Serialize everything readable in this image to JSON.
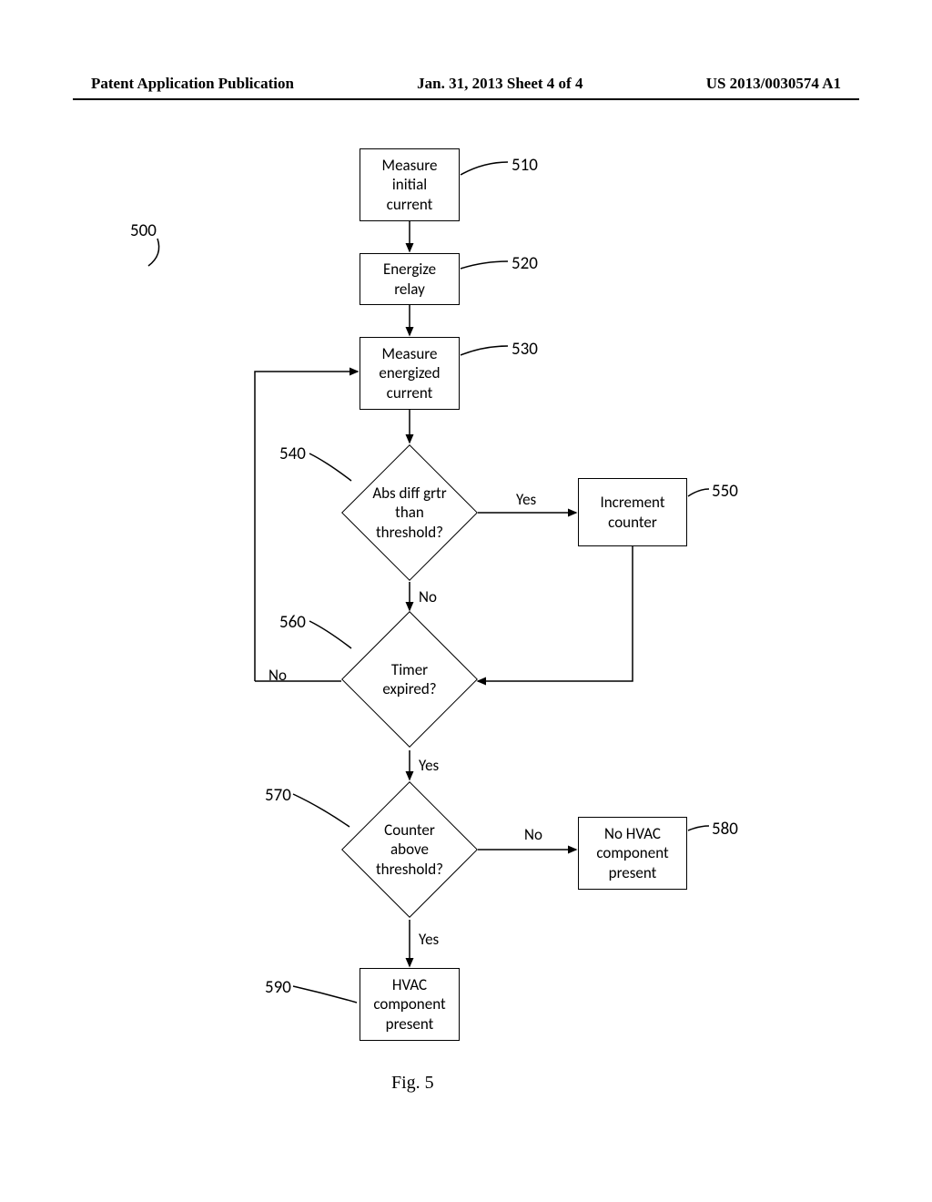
{
  "header": {
    "left": "Patent Application Publication",
    "center": "Jan. 31, 2013  Sheet 4 of 4",
    "right": "US 2013/0030574 A1"
  },
  "figure_ref": "500",
  "figure_caption": "Fig. 5",
  "nodes": {
    "n510": {
      "text": "Measure\ninitial\ncurrent",
      "ref": "510"
    },
    "n520": {
      "text": "Energize\nrelay",
      "ref": "520"
    },
    "n530": {
      "text": "Measure\nenergized\ncurrent",
      "ref": "530"
    },
    "n540": {
      "text": "Abs diff grtr\nthan\nthreshold?",
      "ref": "540"
    },
    "n550": {
      "text": "Increment\ncounter",
      "ref": "550"
    },
    "n560": {
      "text": "Timer\nexpired?",
      "ref": "560"
    },
    "n570": {
      "text": "Counter\nabove\nthreshold?",
      "ref": "570"
    },
    "n580": {
      "text": "No HVAC\ncomponent\npresent",
      "ref": "580"
    },
    "n590": {
      "text": "HVAC\ncomponent\npresent",
      "ref": "590"
    }
  },
  "edges": {
    "e540yes": "Yes",
    "e540no": "No",
    "e560no": "No",
    "e560yes": "Yes",
    "e570no": "No",
    "e570yes": "Yes"
  },
  "chart_data": {
    "type": "flowchart",
    "start": "510",
    "nodes": [
      {
        "id": "510",
        "shape": "process",
        "label": "Measure initial current"
      },
      {
        "id": "520",
        "shape": "process",
        "label": "Energize relay"
      },
      {
        "id": "530",
        "shape": "process",
        "label": "Measure energized current"
      },
      {
        "id": "540",
        "shape": "decision",
        "label": "Abs diff grtr than threshold?"
      },
      {
        "id": "550",
        "shape": "process",
        "label": "Increment counter"
      },
      {
        "id": "560",
        "shape": "decision",
        "label": "Timer expired?"
      },
      {
        "id": "570",
        "shape": "decision",
        "label": "Counter above threshold?"
      },
      {
        "id": "580",
        "shape": "terminal",
        "label": "No HVAC component present"
      },
      {
        "id": "590",
        "shape": "terminal",
        "label": "HVAC component present"
      }
    ],
    "edges": [
      {
        "from": "510",
        "to": "520",
        "label": ""
      },
      {
        "from": "520",
        "to": "530",
        "label": ""
      },
      {
        "from": "530",
        "to": "540",
        "label": ""
      },
      {
        "from": "540",
        "to": "550",
        "label": "Yes"
      },
      {
        "from": "540",
        "to": "560",
        "label": "No"
      },
      {
        "from": "550",
        "to": "560",
        "label": ""
      },
      {
        "from": "560",
        "to": "530",
        "label": "No"
      },
      {
        "from": "560",
        "to": "570",
        "label": "Yes"
      },
      {
        "from": "570",
        "to": "580",
        "label": "No"
      },
      {
        "from": "570",
        "to": "590",
        "label": "Yes"
      }
    ]
  }
}
